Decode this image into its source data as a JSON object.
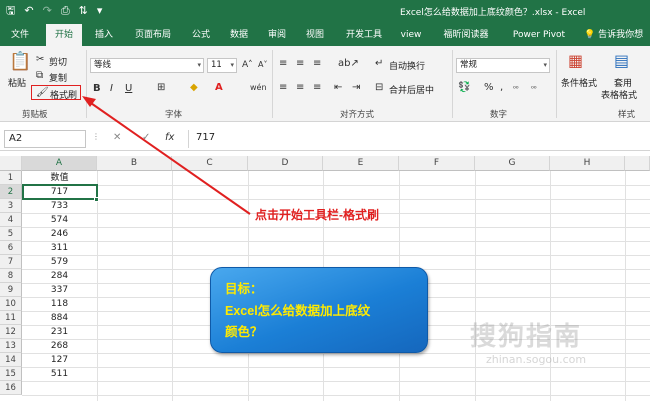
{
  "titlebar": {
    "title": "Excel怎么给数据加上底纹颜色？.xlsx - Excel",
    "qat_icons": [
      "save-icon",
      "undo-icon",
      "redo-icon",
      "print-preview-icon",
      "sort-icon",
      "customize-icon"
    ]
  },
  "tabs": [
    "文件",
    "开始",
    "插入",
    "页面布局",
    "公式",
    "数据",
    "审阅",
    "视图",
    "开发工具",
    "view",
    "福昕阅读器",
    "Power Pivot",
    "告诉我你想"
  ],
  "ribbon": {
    "clipboard": {
      "paste": "粘贴",
      "cut": "剪切",
      "copy": "复制",
      "format_painter": "格式刷",
      "label": "剪贴板"
    },
    "font": {
      "name": "等线",
      "size": "11",
      "label": "字体"
    },
    "alignment": {
      "wrap": "自动换行",
      "merge": "合并后居中",
      "label": "对齐方式"
    },
    "number": {
      "format": "常规",
      "label": "数字"
    },
    "styles": {
      "conditional": "条件格式",
      "table_1": "套用",
      "table_2": "表格格式",
      "label": "样式"
    }
  },
  "formula_bar": {
    "name_box": "A2",
    "cancel": "✕",
    "enter": "✓",
    "fx": "fx",
    "value": "717"
  },
  "sheet": {
    "columns": [
      "A",
      "B",
      "C",
      "D",
      "E",
      "F",
      "G",
      "H"
    ],
    "rows": [
      "1",
      "2",
      "3",
      "4",
      "5",
      "6",
      "7",
      "8",
      "9",
      "10",
      "11",
      "12",
      "13",
      "14",
      "15",
      "16"
    ],
    "colA": [
      "数值",
      "717",
      "733",
      "574",
      "246",
      "311",
      "579",
      "284",
      "337",
      "118",
      "884",
      "231",
      "268",
      "127",
      "511",
      ""
    ]
  },
  "annotation": {
    "text": "点击开始工具栏-格式刷",
    "color": "#e02020"
  },
  "bubble": {
    "line1": "目标：",
    "line2": "Excel怎么给数据加上底纹",
    "line3": "颜色？"
  },
  "watermark": {
    "main": "搜狗指南",
    "sub": "zhinan.sogou.com"
  },
  "colors": {
    "excel_green": "#217346",
    "accent_red": "#e02020",
    "bubble_blue": "#1b7fd6",
    "bubble_text": "#ffea00"
  }
}
